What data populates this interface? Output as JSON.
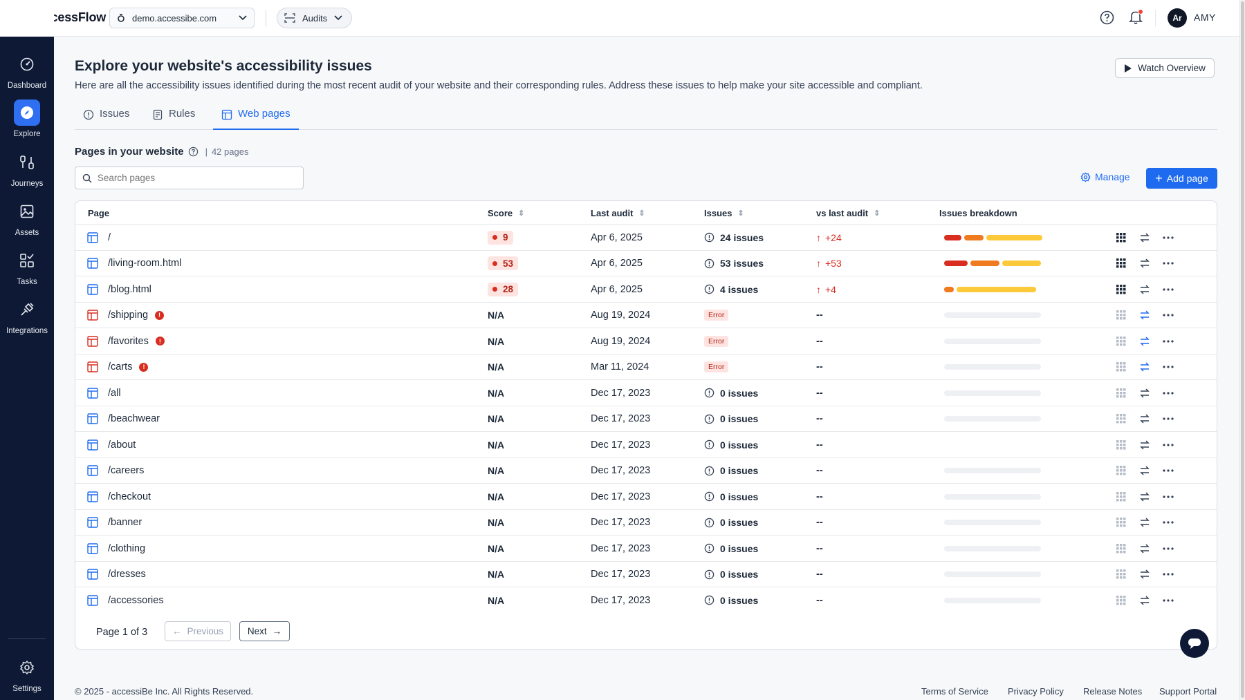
{
  "brand": {
    "name": "accessFlow"
  },
  "topbar": {
    "site": "demo.accessibe.com",
    "audits_label": "Audits",
    "user_initials": "Ar",
    "user_name": "AMY"
  },
  "sidebar": {
    "items": [
      {
        "label": "Dashboard",
        "icon": "dashboard-icon",
        "active": false
      },
      {
        "label": "Explore",
        "icon": "compass-icon",
        "active": true
      },
      {
        "label": "Journeys",
        "icon": "journeys-icon",
        "active": false
      },
      {
        "label": "Assets",
        "icon": "image-icon",
        "active": false
      },
      {
        "label": "Tasks",
        "icon": "tasks-icon",
        "active": false
      },
      {
        "label": "Integrations",
        "icon": "plug-icon",
        "active": false
      }
    ],
    "settings_label": "Settings"
  },
  "header": {
    "title": "Explore your website's accessibility issues",
    "subtitle": "Here are all the accessibility issues identified during the most recent audit of your website and their corresponding rules. Address these issues to help make your site accessible and compliant.",
    "watch_label": "Watch Overview"
  },
  "tabs": [
    {
      "label": "Issues",
      "active": false
    },
    {
      "label": "Rules",
      "active": false
    },
    {
      "label": "Web pages",
      "active": true
    }
  ],
  "section": {
    "title": "Pages in your website",
    "separator": "|",
    "count": "42 pages",
    "search_placeholder": "Search pages",
    "manage_label": "Manage",
    "add_label": "Add page"
  },
  "table": {
    "columns": [
      "Page",
      "Score",
      "Last audit",
      "Issues",
      "vs last audit",
      "Issues breakdown"
    ],
    "rows": [
      {
        "page": "/",
        "error": false,
        "score": "9",
        "date": "Apr 6, 2025",
        "issues": "24 issues",
        "delta": "+24",
        "breakdown": [
          0.18,
          0.2,
          0.58
        ]
      },
      {
        "page": "/living-room.html",
        "error": false,
        "score": "53",
        "date": "Apr 6, 2025",
        "issues": "53 issues",
        "delta": "+53",
        "breakdown": [
          0.24,
          0.3,
          0.4
        ]
      },
      {
        "page": "/blog.html",
        "error": false,
        "score": "28",
        "date": "Apr 6, 2025",
        "issues": "4 issues",
        "delta": "+4",
        "breakdown": [
          0,
          0.1,
          0.82
        ]
      },
      {
        "page": "/shipping",
        "error": true,
        "score": "N/A",
        "date": "Aug 19, 2024",
        "issues": "Error",
        "delta": "--",
        "breakdown": null
      },
      {
        "page": "/favorites",
        "error": true,
        "score": "N/A",
        "date": "Aug 19, 2024",
        "issues": "Error",
        "delta": "--",
        "breakdown": null
      },
      {
        "page": "/carts",
        "error": true,
        "score": "N/A",
        "date": "Mar 11, 2024",
        "issues": "Error",
        "delta": "--",
        "breakdown": null
      },
      {
        "page": "/all",
        "error": false,
        "score": "N/A",
        "date": "Dec 17, 2023",
        "issues": "0 issues",
        "delta": "--",
        "breakdown": null
      },
      {
        "page": "/beachwear",
        "error": false,
        "score": "N/A",
        "date": "Dec 17, 2023",
        "issues": "0 issues",
        "delta": "--",
        "breakdown": null
      },
      {
        "page": "/about",
        "error": false,
        "score": "N/A",
        "date": "Dec 17, 2023",
        "issues": "0 issues",
        "delta": "--",
        "breakdown": null
      },
      {
        "page": "/careers",
        "error": false,
        "score": "N/A",
        "date": "Dec 17, 2023",
        "issues": "0 issues",
        "delta": "--",
        "breakdown": null
      },
      {
        "page": "/checkout",
        "error": false,
        "score": "N/A",
        "date": "Dec 17, 2023",
        "issues": "0 issues",
        "delta": "--",
        "breakdown": null
      },
      {
        "page": "/banner",
        "error": false,
        "score": "N/A",
        "date": "Dec 17, 2023",
        "issues": "0 issues",
        "delta": "--",
        "breakdown": null
      },
      {
        "page": "/clothing",
        "error": false,
        "score": "N/A",
        "date": "Dec 17, 2023",
        "issues": "0 issues",
        "delta": "--",
        "breakdown": null
      },
      {
        "page": "/dresses",
        "error": false,
        "score": "N/A",
        "date": "Dec 17, 2023",
        "issues": "0 issues",
        "delta": "--",
        "breakdown": null
      },
      {
        "page": "/accessories",
        "error": false,
        "score": "N/A",
        "date": "Dec 17, 2023",
        "issues": "0 issues",
        "delta": "--",
        "breakdown": null
      }
    ]
  },
  "pagination": {
    "label": "Page 1 of 3",
    "prev_label": "Previous",
    "next_label": "Next"
  },
  "footer": {
    "copyright": "© 2025 - accessiBe Inc. All Rights Reserved.",
    "links": [
      "Terms of Service",
      "Privacy Policy",
      "Release Notes",
      "Support Portal"
    ]
  },
  "colors": {
    "accent": "#1f6bf0",
    "sidebar": "#0e1a35",
    "critical": "#d92d20",
    "serious": "#f07a1f",
    "moderate": "#fcc93a"
  }
}
